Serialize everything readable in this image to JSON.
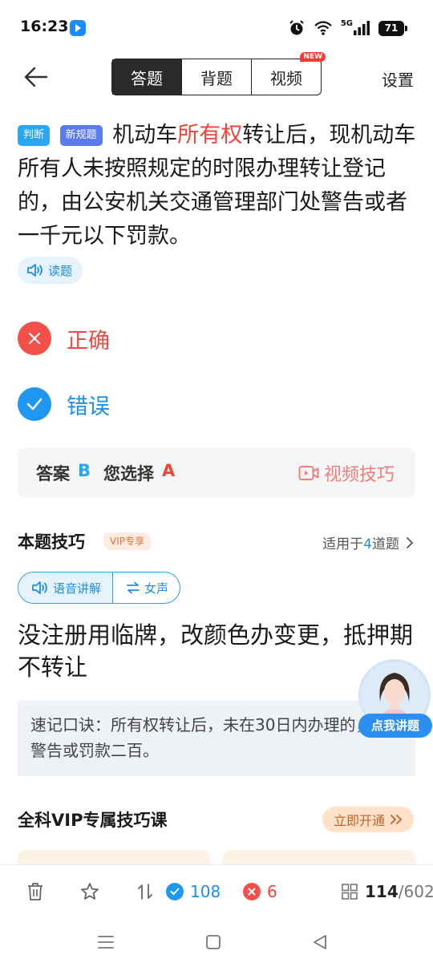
{
  "status_bar": {
    "time": "16:23",
    "network": "5G",
    "battery": "71",
    "icons": [
      "alarm-icon",
      "wifi-icon",
      "signal-icon",
      "battery-icon"
    ]
  },
  "header": {
    "tabs": [
      {
        "label": "答题",
        "active": true
      },
      {
        "label": "背题",
        "active": false
      },
      {
        "label": "视频",
        "active": false,
        "badge": "NEW"
      }
    ],
    "settings_label": "设置"
  },
  "question": {
    "tags": [
      "判断",
      "新规题"
    ],
    "text_before": "机动车",
    "highlight": "所有权",
    "text_after": "转让后，现机动车所有人未按照规定的时限办理转让登记的，由公安机关交通管理部门处警告或者一千元以下罚款。",
    "read_label": "读题"
  },
  "options": [
    {
      "label": "正确",
      "state": "wrong"
    },
    {
      "label": "错误",
      "state": "correct"
    }
  ],
  "answer": {
    "answer_label": "答案",
    "answer_value": "B",
    "selected_label": "您选择",
    "selected_value": "A",
    "video_tip_label": "视频技巧"
  },
  "tips": {
    "title": "本题技巧",
    "vip_tag": "VIP专享",
    "applies_prefix": "适用于",
    "applies_count": "4",
    "applies_suffix": "道题",
    "voice_label": "语音讲解",
    "switch_label": "女声",
    "main_text": "没注册用临牌，改颜色办变更，抵押期不转让",
    "mnemonic": "速记口诀：所有权转让后，未在30日内办理的，处警告或罚款二百。",
    "avatar_button": "点我讲题"
  },
  "course": {
    "title": "全科VIP专属技巧课",
    "open_label": "立即开通"
  },
  "toolbar": {
    "correct_count": "108",
    "wrong_count": "6",
    "current": "114",
    "total": "/602"
  },
  "colors": {
    "accent_blue": "#1c8fe8",
    "error_red": "#f0443a",
    "tab_active": "#2a2a2a",
    "vip_orange": "#e0723a"
  }
}
